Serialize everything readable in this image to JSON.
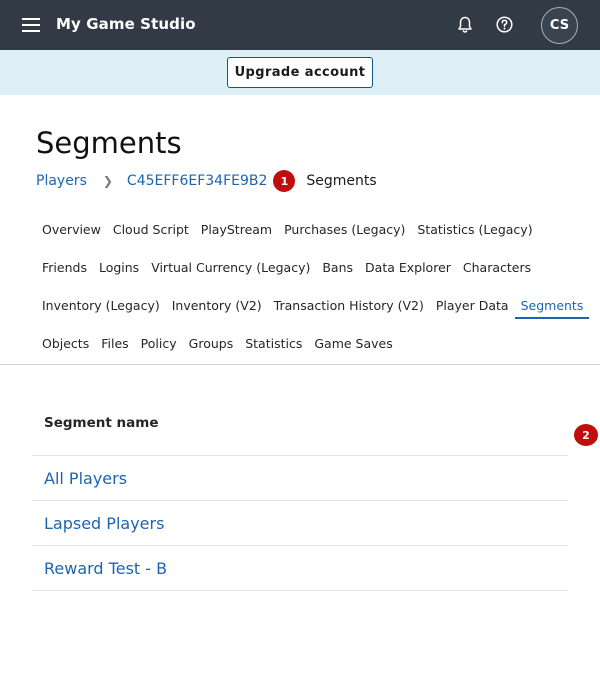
{
  "header": {
    "app_title": "My Game Studio",
    "avatar_initials": "CS",
    "icons": [
      "menu-icon",
      "bell-icon",
      "help-icon"
    ]
  },
  "banner": {
    "upgrade_label": "Upgrade account"
  },
  "page": {
    "title": "Segments"
  },
  "breadcrumb": {
    "players": "Players",
    "player_id": "C45EFF6EF34FE9B2",
    "badge": "1",
    "current": "Segments"
  },
  "tabs": {
    "row1": [
      "Overview",
      "Cloud Script",
      "PlayStream",
      "Purchases (Legacy)",
      "Statistics (Legacy)"
    ],
    "row2": [
      "Friends",
      "Logins",
      "Virtual Currency (Legacy)",
      "Bans",
      "Data Explorer",
      "Characters"
    ],
    "row3": [
      "Inventory (Legacy)",
      "Inventory (V2)",
      "Transaction History (V2)",
      "Player Data",
      "Segments"
    ],
    "row4": [
      "Objects",
      "Files",
      "Policy",
      "Groups",
      "Statistics",
      "Game Saves"
    ],
    "active": "Segments"
  },
  "table": {
    "header": "Segment name",
    "badge": "2",
    "rows": [
      "All Players",
      "Lapsed Players",
      "Reward Test - B"
    ]
  },
  "colors": {
    "topbar": "#323a45",
    "banner": "#dfeff8",
    "link": "#1d65b0",
    "badge": "#c00d0d"
  }
}
